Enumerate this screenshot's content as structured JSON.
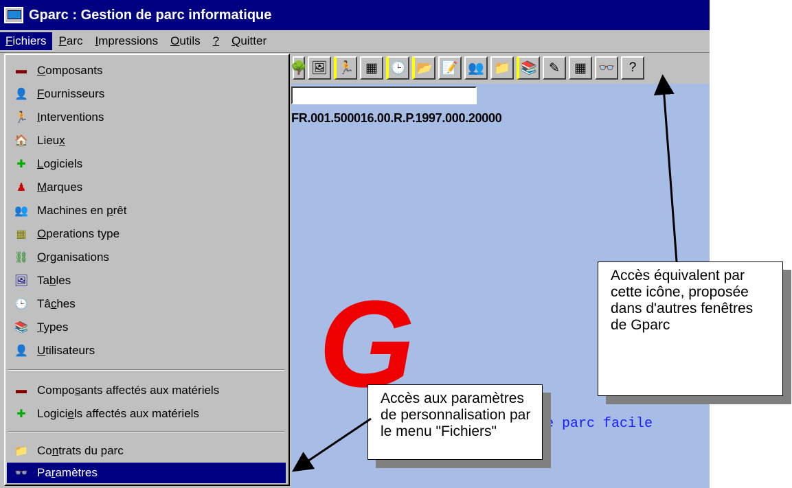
{
  "window": {
    "title": "Gparc : Gestion de parc informatique"
  },
  "menubar": {
    "items": [
      {
        "label": "Fichiers",
        "u": "F",
        "rest": "ichiers",
        "active": true
      },
      {
        "label": "Parc",
        "u": "P",
        "rest": "arc"
      },
      {
        "label": "Impressions",
        "u": "I",
        "rest": "mpressions"
      },
      {
        "label": "Outils",
        "u": "O",
        "rest": "utils"
      },
      {
        "label": "?",
        "u": "?",
        "rest": ""
      },
      {
        "label": "Quitter",
        "u": "Q",
        "rest": "uitter"
      }
    ]
  },
  "toolbar": {
    "icons": [
      "column-tool-icon",
      "table-card-icon",
      "interventions-icon",
      "calculator-icon",
      "clock-icon",
      "folder-open-icon",
      "edit-document-icon",
      "loan-machines-icon",
      "folder-icon",
      "types-icon",
      "pen-icon",
      "grid-icon",
      "glasses-icon",
      "help-icon"
    ],
    "glyphs": [
      "🌳",
      "🖼",
      "🏃",
      "▦",
      "🕒",
      "📂",
      "📝",
      "👥",
      "📁",
      "📚",
      "✎",
      "▦",
      "👓",
      "?"
    ],
    "separators": [
      2,
      4,
      5,
      9
    ]
  },
  "main": {
    "serial": "FR.001.500016.00.R.P.1997.000.20000",
    "logo_text": "G",
    "tagline": "e parc facile"
  },
  "fichiers_menu": {
    "items": [
      {
        "pre": "",
        "u": "C",
        "post": "omposants",
        "icon": "components-icon",
        "glyph": "▬",
        "color": "#800000"
      },
      {
        "pre": "",
        "u": "F",
        "post": "ournisseurs",
        "icon": "supplier-icon",
        "glyph": "👤",
        "color": "#000000"
      },
      {
        "pre": "",
        "u": "I",
        "post": "nterventions",
        "icon": "interventions-icon",
        "glyph": "🏃",
        "color": "#cc0000"
      },
      {
        "pre": "Lieu",
        "u": "x",
        "post": "",
        "icon": "location-icon",
        "glyph": "🏠",
        "color": "#0000aa"
      },
      {
        "pre": "",
        "u": "L",
        "post": "ogiciels",
        "icon": "software-icon",
        "glyph": "✚",
        "color": "#00aa00"
      },
      {
        "pre": "",
        "u": "M",
        "post": "arques",
        "icon": "brands-icon",
        "glyph": "♟",
        "color": "#cc0000"
      },
      {
        "pre": "Machines en ",
        "u": "p",
        "post": "rêt",
        "icon": "loan-machines-icon",
        "glyph": "👥",
        "color": "#806000"
      },
      {
        "pre": "",
        "u": "O",
        "post": "perations type",
        "icon": "operations-icon",
        "glyph": "▦",
        "color": "#808000"
      },
      {
        "pre": "",
        "u": "O",
        "post": "rganisations",
        "icon": "organizations-icon",
        "glyph": "⛓",
        "color": "#008000"
      },
      {
        "pre": "Ta",
        "u": "b",
        "post": "les",
        "icon": "tables-icon",
        "glyph": "🖼",
        "color": "#000080"
      },
      {
        "pre": "Tâ",
        "u": "c",
        "post": "hes",
        "icon": "clock-icon",
        "glyph": "🕒",
        "color": "#0000aa"
      },
      {
        "pre": "",
        "u": "T",
        "post": "ypes",
        "icon": "types-icon",
        "glyph": "📚",
        "color": "#806000"
      },
      {
        "pre": "",
        "u": "U",
        "post": "tilisateurs",
        "icon": "users-icon",
        "glyph": "👤",
        "color": "#806000"
      },
      {
        "pre": "Compo",
        "u": "s",
        "post": "ants affectés aux matériels",
        "icon": "components-icon",
        "glyph": "▬",
        "color": "#800000"
      },
      {
        "pre": "Logici",
        "u": "e",
        "post": "ls affectés aux matériels",
        "icon": "software-icon",
        "glyph": "✚",
        "color": "#00aa00"
      },
      {
        "pre": "Co",
        "u": "n",
        "post": "trats du parc",
        "icon": "folder-icon",
        "glyph": "📁",
        "color": "#c8a000"
      },
      {
        "pre": "Pa",
        "u": "r",
        "post": "amètres",
        "icon": "glasses-icon",
        "glyph": "👓",
        "color": "#c8a000",
        "selected": true
      }
    ]
  },
  "callouts": {
    "menu": "Accès aux paramètres de personnalisation par le menu \"Fichiers\"",
    "icon": "Accès équivalent par cette icône, proposée dans d'autres fenêtres de Gparc"
  }
}
